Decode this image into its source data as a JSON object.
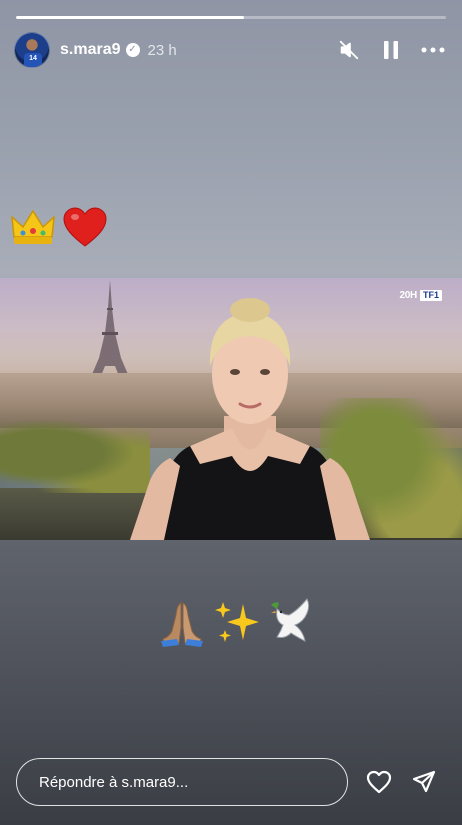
{
  "story": {
    "progress": 0.53,
    "user": {
      "username": "s.mara9",
      "verified_icon": "verified-badge-icon",
      "time_ago": "23 h",
      "avatar_jersey_number": "14"
    },
    "header_icons": [
      "speaker-muted-icon",
      "pause-icon",
      "more-icon"
    ],
    "emoji_top": [
      "👑",
      "❤️"
    ],
    "emoji_bottom": [
      "🙏🏽",
      "✨",
      "🕊️"
    ],
    "video": {
      "broadcast_time": "20H",
      "channel_logo": "TF1"
    },
    "reply": {
      "placeholder": "Répondre à s.mara9..."
    },
    "reply_icons": [
      "heart-icon",
      "send-icon"
    ]
  },
  "colors": {
    "background_top": "#8f95a4",
    "background_bottom": "#3a3d44",
    "accent": "#ffffff",
    "channel_blue": "#1c3d8f"
  }
}
